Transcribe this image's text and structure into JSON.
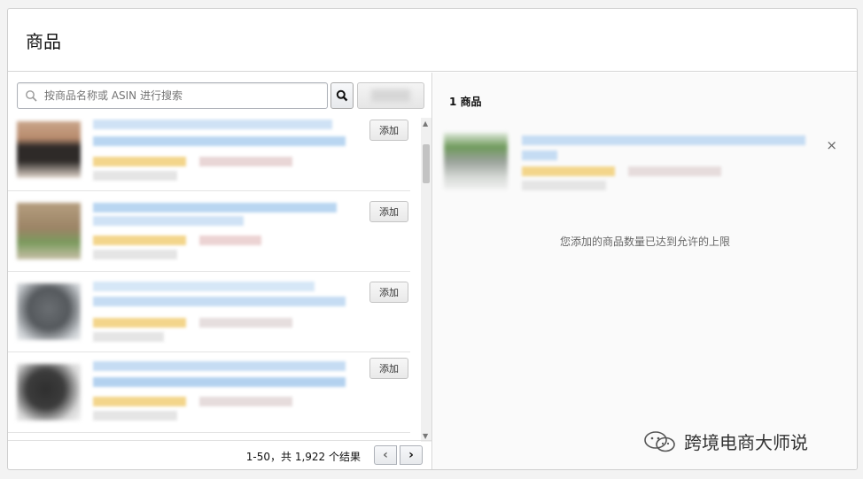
{
  "page": {
    "title": "商品"
  },
  "search": {
    "placeholder": "按商品名称或 ASIN 进行搜索"
  },
  "items": [
    {
      "add_label": "添加"
    },
    {
      "add_label": "添加"
    },
    {
      "add_label": "添加"
    },
    {
      "add_label": "添加"
    }
  ],
  "footer": {
    "results": "1-50，共 1,922 个结果",
    "prev_icon": "chevron-left-icon",
    "next_icon": "chevron-right-icon",
    "prev": "‹",
    "next": "›"
  },
  "selected": {
    "count_label": "1 商品",
    "limit_message": "您添加的商品数量已达到允许的上限",
    "remove_icon": "close-icon",
    "remove": "×"
  },
  "watermark": {
    "text": "跨境电商大师说"
  },
  "colors": {
    "accent_blue": "#a9cdef",
    "badge_yellow": "#f3d58b",
    "border": "#d5d5d5"
  }
}
